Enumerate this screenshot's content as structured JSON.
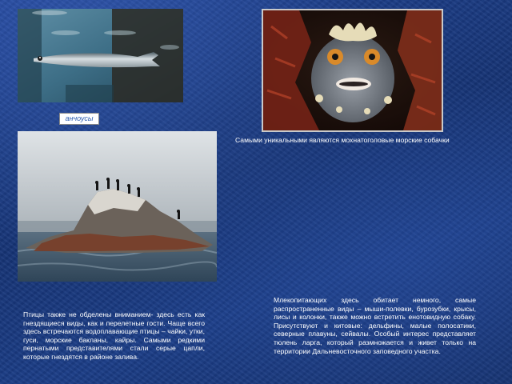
{
  "anchovy_label": "анчоусы",
  "fish_caption": "Самыми уникальными являются мохнатоголовые морские собачки",
  "mammals_text": "Млекопитающих здесь обитает немного, самые распространенные виды – мыши-полевки, бурозубки, крысы, лисы и колонки, также можно встретить енотовидную собаку. Присутствуют и китовые: дельфины, малые полосатики, северные плавуны, сейвалы. Особый интерес представляет тюлень ларга, который размножается и живет только на территории Дальневосточного заповедного участка.",
  "birds_text": "Птицы также не обделены вниманием- здесь есть как гнездящиеся виды, как и перелетные гости. Чаще всего здесь встречаются водоплавающие птицы – чайки, утки, гуси, морские бакланы, кайры. Самыми редкими пернатыми представителями стали серые цапли, которые гнездятся в районе залива."
}
